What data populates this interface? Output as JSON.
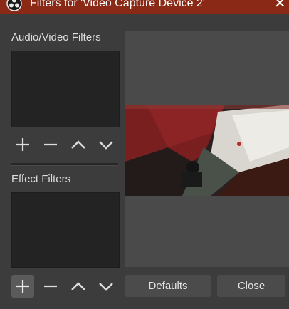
{
  "window": {
    "title": "Filters for 'Video Capture Device 2'",
    "close_icon": "close-icon"
  },
  "audio_video": {
    "label": "Audio/Video Filters",
    "items": []
  },
  "effect": {
    "label": "Effect Filters",
    "items": []
  },
  "toolbar_icons": [
    "plus-icon",
    "minus-icon",
    "chevron-up-icon",
    "chevron-down-icon"
  ],
  "buttons": {
    "defaults": "Defaults",
    "close": "Close"
  },
  "colors": {
    "titlebar": "#8a2a16",
    "background": "#3c3c3c",
    "list_bg": "#232323",
    "button_bg": "#4b4b4b"
  }
}
